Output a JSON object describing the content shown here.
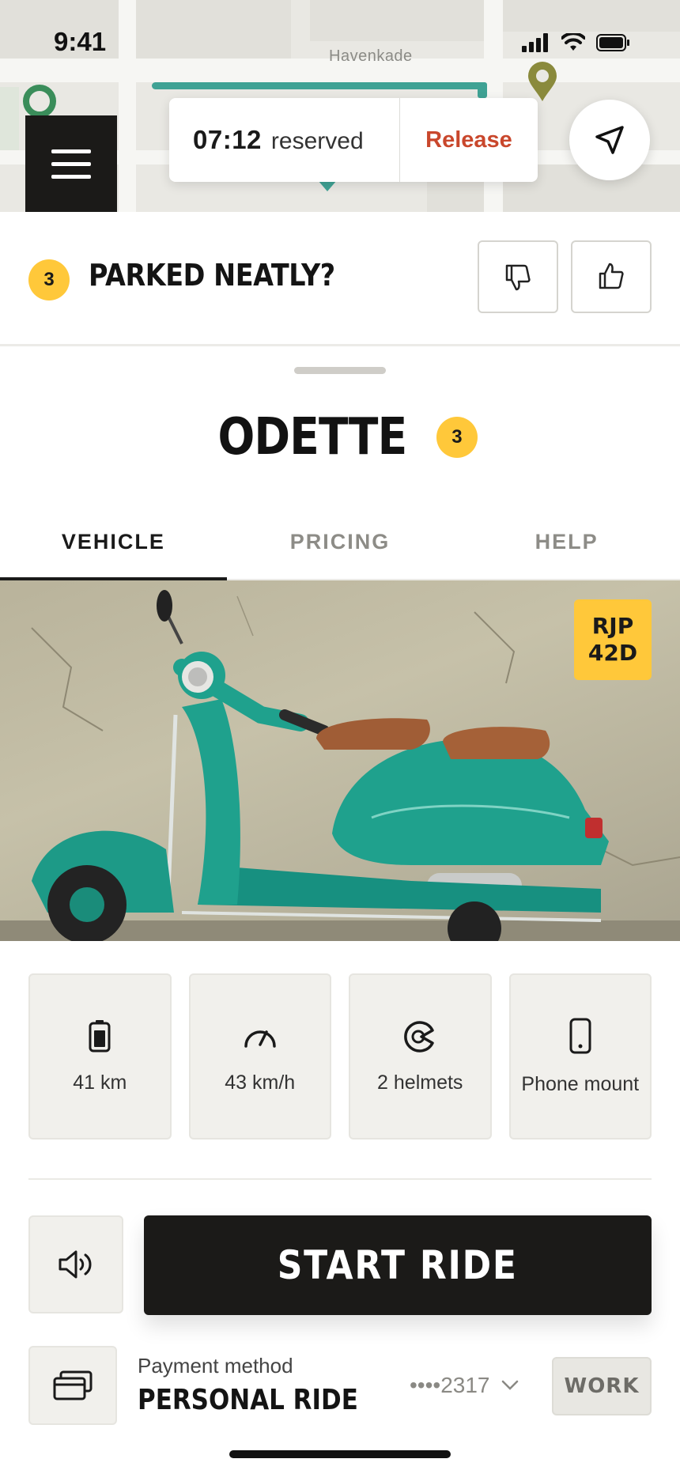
{
  "status_bar": {
    "time": "9:41"
  },
  "map": {
    "street_label": "Havenkade"
  },
  "reservation": {
    "time": "07:12",
    "status": "reserved",
    "release_label": "Release"
  },
  "feedback": {
    "badge": "3",
    "question": "PARKED NEATLY?"
  },
  "vehicle": {
    "name": "ODETTE",
    "badge": "3",
    "plate_line1": "RJP",
    "plate_line2": "42D"
  },
  "tabs": [
    {
      "label": "VEHICLE",
      "active": true
    },
    {
      "label": "PRICING",
      "active": false
    },
    {
      "label": "HELP",
      "active": false
    }
  ],
  "specs": [
    {
      "icon": "battery-icon",
      "label": "41 km"
    },
    {
      "icon": "speedometer-icon",
      "label": "43 km/h"
    },
    {
      "icon": "helmet-icon",
      "label": "2 helmets"
    },
    {
      "icon": "phone-icon",
      "label": "Phone mount"
    }
  ],
  "actions": {
    "start_label": "START RIDE"
  },
  "payment": {
    "caption": "Payment method",
    "title": "PERSONAL RIDE",
    "card": "••••2317",
    "tag": "WORK"
  },
  "colors": {
    "accent_yellow": "#ffc83a",
    "release_red": "#c9472c",
    "route_teal": "#3fa294",
    "dark": "#1b1a18"
  }
}
